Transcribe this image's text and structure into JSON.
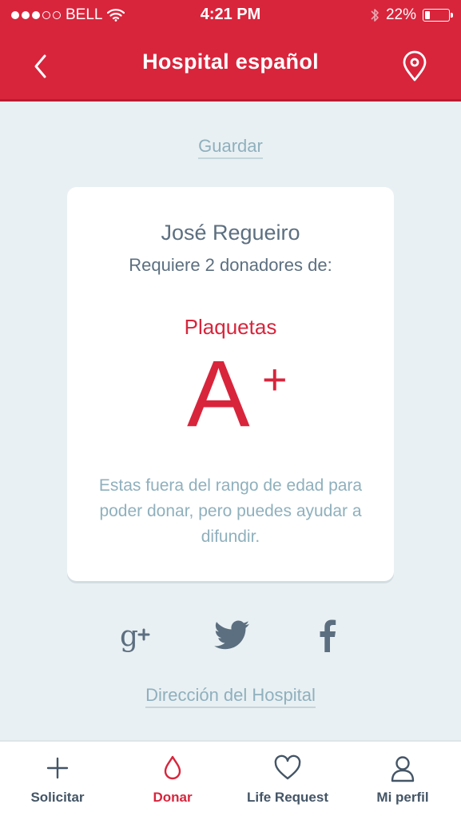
{
  "status_bar": {
    "carrier": "BELL",
    "time": "4:21 PM",
    "battery": "22%",
    "battery_level": 0.22,
    "signal_bars_filled": 3,
    "signal_bars_total": 5
  },
  "header": {
    "title": "Hospital español",
    "back_icon": "chevron-left-icon",
    "location_icon": "map-pin-icon"
  },
  "save_link": "Guardar",
  "card": {
    "donor_name": "José Regueiro",
    "requirement": "Requiere 2 donadores de:",
    "component": "Plaquetas",
    "blood_group": "A",
    "rh_factor": "+",
    "message": "Estas fuera del rango de edad para poder donar, pero puedes ayudar a difundir."
  },
  "share": {
    "icons": [
      "google-plus-icon",
      "twitter-icon",
      "facebook-icon"
    ]
  },
  "hospital_link": "Dirección del Hospital",
  "tabbar": {
    "tabs": [
      {
        "label": "Solicitar",
        "icon": "plus-icon",
        "active": false
      },
      {
        "label": "Donar",
        "icon": "blood-drop-icon",
        "active": true
      },
      {
        "label": "Life Request",
        "icon": "heart-icon",
        "active": false
      },
      {
        "label": "Mi perfil",
        "icon": "user-icon",
        "active": false
      }
    ]
  },
  "colors": {
    "brand_red": "#d8253c",
    "background": "#e9f0f3",
    "text_dark": "#5c6f80",
    "text_muted": "#8fb0bd"
  }
}
